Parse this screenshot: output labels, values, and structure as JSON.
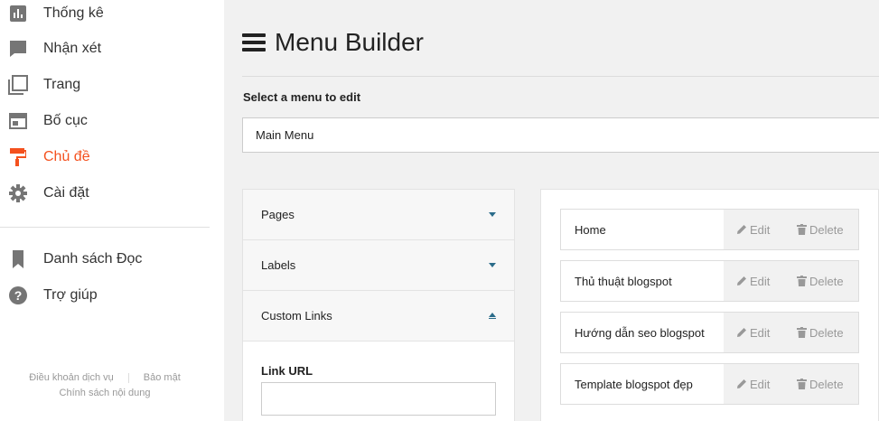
{
  "sidebar": {
    "items": [
      {
        "label": "Thống kê",
        "icon": "bar-chart-icon",
        "active": false
      },
      {
        "label": "Nhận xét",
        "icon": "comment-icon",
        "active": false
      },
      {
        "label": "Trang",
        "icon": "pages-icon",
        "active": false
      },
      {
        "label": "Bố cục",
        "icon": "layout-icon",
        "active": false
      },
      {
        "label": "Chủ đề",
        "icon": "paint-roller-icon",
        "active": true
      },
      {
        "label": "Cài đặt",
        "icon": "gear-icon",
        "active": false
      },
      {
        "label": "Danh sách Đọc",
        "icon": "bookmark-icon",
        "active": false
      },
      {
        "label": "Trợ giúp",
        "icon": "help-icon",
        "active": false
      }
    ],
    "footer": {
      "terms": "Điều khoản dịch vụ",
      "privacy": "Bảo mật",
      "content_policy": "Chính sách nội dung"
    }
  },
  "main": {
    "title": "Menu Builder",
    "select_label": "Select a menu to edit",
    "selected_menu": "Main Menu",
    "accordion": {
      "pages": "Pages",
      "labels": "Labels",
      "custom_links": "Custom Links",
      "link_url_label": "Link URL",
      "link_url_value": ""
    },
    "menu_items": [
      {
        "label": "Home",
        "edit": "Edit",
        "delete": "Delete"
      },
      {
        "label": "Thủ thuật blogspot",
        "edit": "Edit",
        "delete": "Delete"
      },
      {
        "label": "Hướng dẫn seo blogspot",
        "edit": "Edit",
        "delete": "Delete"
      },
      {
        "label": "Template blogspot đẹp",
        "edit": "Edit",
        "delete": "Delete"
      }
    ]
  },
  "colors": {
    "accent": "#f4511e",
    "caret": "#2b6c8a",
    "icon_gray": "#757575",
    "main_bg": "#f1f1f1"
  }
}
